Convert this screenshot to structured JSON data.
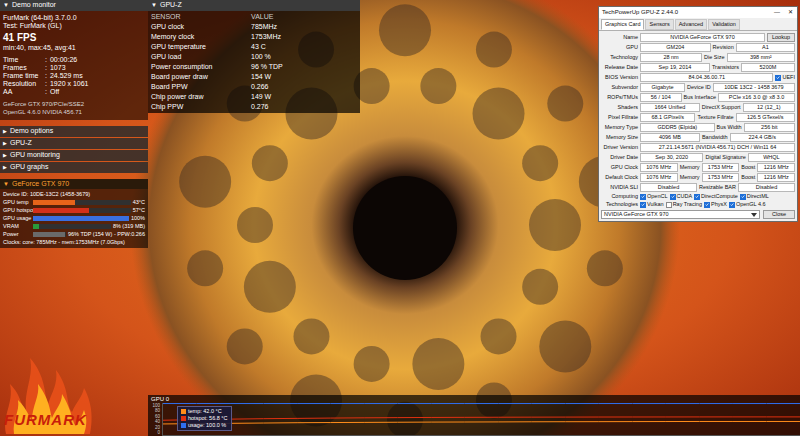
{
  "demo_monitor": {
    "title": "Demo monitor",
    "arrow": "▼",
    "header_lines": [
      "FurMark (64-bit) 3.7.0.0",
      "Test: FurMark (GL)"
    ],
    "fps": "41 FPS",
    "stats": "min:40, max:45, avg:41",
    "fields": [
      {
        "label": "Time",
        "value": "00:00:26"
      },
      {
        "label": "Frames",
        "value": "1073"
      },
      {
        "label": "Frame time",
        "value": "24.529 ms"
      },
      {
        "label": "Resolution",
        "value": "1920 x 1061"
      },
      {
        "label": "AA",
        "value": "Off"
      }
    ],
    "separator": ":",
    "gpu_lines": [
      "GeForce GTX 970/PCIe/SSE2",
      "OpenGL 4.6.0 NVIDIA 456.71"
    ],
    "menu": [
      {
        "label": "Demo options",
        "arrow": "▶",
        "expanded": false
      },
      {
        "label": "GPU-Z",
        "arrow": "▶",
        "expanded": false
      },
      {
        "label": "GPU monitoring",
        "arrow": "▶",
        "expanded": false
      },
      {
        "label": "GPU graphs",
        "arrow": "▶",
        "expanded": false
      }
    ]
  },
  "gpu_card": {
    "title": "GeForce GTX 970",
    "arrow": "▼",
    "expanded": true,
    "device": "Device ID: 10DE-13C2 (1458-3679)",
    "meters": [
      {
        "label": "GPU temp",
        "reading": "43°C",
        "level": 0.43,
        "color": "#e8641a"
      },
      {
        "label": "GPU hotspot",
        "reading": "57°C",
        "level": 0.57,
        "color": "#d4301a"
      },
      {
        "label": "GPU usage",
        "reading": "100%",
        "level": 1,
        "color": "#3a6fe0"
      },
      {
        "label": "VRAM",
        "reading": "8% (319 MB)",
        "level": 0.08,
        "color": "#2a9a3a"
      },
      {
        "label": "Power",
        "reading": "96% TDP (154 W) - PPW:0.266",
        "level": 0.96,
        "color": "#6a6a6a"
      }
    ],
    "clocks": "Clocks: core: 785MHz - mem:1753MHz (7.0Gbps)"
  },
  "gpuz_panel": {
    "title": "GPU-Z",
    "arrow": "▼",
    "columns": [
      "SENSOR",
      "VALUE"
    ],
    "rows": [
      {
        "sensor": "GPU clock",
        "value": "785MHz"
      },
      {
        "sensor": "Memory clock",
        "value": "1753MHz"
      },
      {
        "sensor": "GPU temperature",
        "value": "43 C"
      },
      {
        "sensor": "GPU load",
        "value": "100 %"
      },
      {
        "sensor": "Power consumption",
        "value": "96 % TDP"
      },
      {
        "sensor": "Board power draw",
        "value": "154 W"
      },
      {
        "sensor": "Board PPW",
        "value": "0.266"
      },
      {
        "sensor": "Chip power draw",
        "value": "149 W"
      },
      {
        "sensor": "Chip PPW",
        "value": "0.276"
      }
    ]
  },
  "gpuz_window": {
    "title": "TechPowerUp GPU-Z 2.44.0",
    "controls": [
      "—",
      "✕"
    ],
    "tabs": [
      {
        "label": "Graphics Card",
        "selected": true
      },
      {
        "label": "Sensors",
        "selected": false
      },
      {
        "label": "Advanced",
        "selected": false
      },
      {
        "label": "Validation",
        "selected": false
      }
    ],
    "rows": [
      {
        "items": [
          {
            "kind": "field",
            "label": "Name",
            "value": "NVIDIA GeForce GTX 970"
          },
          {
            "kind": "button",
            "label": "Lookup"
          }
        ]
      },
      {
        "items": [
          {
            "kind": "field",
            "label": "GPU",
            "value": "GM204"
          },
          {
            "kind": "field",
            "label": "Revision",
            "value": "A1"
          }
        ]
      },
      {
        "items": [
          {
            "kind": "field",
            "label": "Technology",
            "value": "28 nm"
          },
          {
            "kind": "field",
            "label": "Die Size",
            "value": "398 mm²"
          }
        ]
      },
      {
        "items": [
          {
            "kind": "field",
            "label": "Release Date",
            "value": "Sep 19, 2014"
          },
          {
            "kind": "field",
            "label": "Transistors",
            "value": "5200M"
          }
        ]
      },
      {
        "items": [
          {
            "kind": "field",
            "label": "BIOS Version",
            "value": "84.04.36.00.71"
          },
          {
            "kind": "checkbox",
            "label": "UEFI",
            "checked": true
          }
        ]
      },
      {
        "items": [
          {
            "kind": "field",
            "label": "Subvendor",
            "value": "Gigabyte"
          },
          {
            "kind": "field",
            "label": "Device ID",
            "value": "10DE 13C2 - 1458 3679"
          }
        ]
      },
      {
        "items": [
          {
            "kind": "field",
            "label": "ROPs/TMUs",
            "value": "56 / 104"
          },
          {
            "kind": "field",
            "label": "Bus Interface",
            "value": "PCIe x16 3.0 @ x8 3.0"
          }
        ]
      },
      {
        "items": [
          {
            "kind": "field",
            "label": "Shaders",
            "value": "1664 Unified"
          },
          {
            "kind": "field",
            "label": "DirectX Support",
            "value": "12 (12_1)"
          }
        ]
      },
      {
        "items": [
          {
            "kind": "field",
            "label": "Pixel Fillrate",
            "value": "68.1 GPixel/s"
          },
          {
            "kind": "field",
            "label": "Texture Fillrate",
            "value": "126.5 GTexel/s"
          }
        ]
      },
      {
        "items": [
          {
            "kind": "field",
            "label": "Memory Type",
            "value": "GDDR5 (Elpida)"
          },
          {
            "kind": "field",
            "label": "Bus Width",
            "value": "256 bit"
          }
        ]
      },
      {
        "items": [
          {
            "kind": "field",
            "label": "Memory Size",
            "value": "4096 MB"
          },
          {
            "kind": "field",
            "label": "Bandwidth",
            "value": "224.4 GB/s"
          }
        ]
      },
      {
        "items": [
          {
            "kind": "field",
            "label": "Driver Version",
            "value": "27.21.14.5671 (NVIDIA 456.71) DCH / Win11 64"
          }
        ]
      },
      {
        "items": [
          {
            "kind": "field",
            "label": "Driver Date",
            "value": "Sep 30, 2020"
          },
          {
            "kind": "field",
            "label": "Digital Signature",
            "value": "WHQL"
          }
        ]
      },
      {
        "items": [
          {
            "kind": "field",
            "label": "GPU Clock",
            "value": "1076 MHz"
          },
          {
            "kind": "field",
            "label": "Memory",
            "value": "1753 MHz"
          },
          {
            "kind": "field",
            "label": "Boost",
            "value": "1216 MHz"
          }
        ]
      },
      {
        "items": [
          {
            "kind": "field",
            "label": "Default Clock",
            "value": "1076 MHz"
          },
          {
            "kind": "field",
            "label": "Memory",
            "value": "1753 MHz"
          },
          {
            "kind": "field",
            "label": "Boost",
            "value": "1216 MHz"
          }
        ]
      },
      {
        "items": [
          {
            "kind": "field",
            "label": "NVIDIA SLI",
            "value": "Disabled"
          },
          {
            "kind": "field",
            "label": "Resizable BAR",
            "value": "Disabled"
          }
        ]
      },
      {
        "items": [
          {
            "kind": "label",
            "label": "Computing"
          },
          {
            "kind": "checkbox",
            "label": "OpenCL",
            "checked": true
          },
          {
            "kind": "checkbox",
            "label": "CUDA",
            "checked": true
          },
          {
            "kind": "checkbox",
            "label": "DirectCompute",
            "checked": true
          },
          {
            "kind": "checkbox",
            "label": "DirectML",
            "checked": true
          }
        ]
      },
      {
        "items": [
          {
            "kind": "label",
            "label": "Technologies"
          },
          {
            "kind": "checkbox",
            "label": "Vulkan",
            "checked": true
          },
          {
            "kind": "checkbox",
            "label": "Ray Tracing",
            "checked": false
          },
          {
            "kind": "checkbox",
            "label": "PhysX",
            "checked": true
          },
          {
            "kind": "checkbox",
            "label": "OpenGL 4.6",
            "checked": true
          }
        ]
      }
    ],
    "device_select": "NVIDIA GeForce GTX 970",
    "close_button": "Close"
  },
  "graph": {
    "title": "GPU 0",
    "ticks": [
      "100",
      "80",
      "60",
      "40",
      "20",
      "0"
    ],
    "max": 100,
    "series": [
      {
        "label": "temp: 42.0 °C",
        "color": "#ff8c1a",
        "values": [
          34,
          35,
          36,
          37,
          38,
          38.5,
          39,
          39.5,
          40,
          40.3,
          40.6,
          41,
          41.2,
          41.4,
          41.6,
          41.8,
          42,
          42,
          42,
          42
        ]
      },
      {
        "label": "hotspot: 56.8 °C",
        "color": "#e03010",
        "values": [
          46,
          48,
          49.5,
          51,
          52,
          53,
          53.8,
          54.4,
          55,
          55.4,
          55.7,
          56,
          56.2,
          56.4,
          56.5,
          56.6,
          56.7,
          56.8,
          56.8,
          56.8
        ]
      },
      {
        "label": "usage: 100.0 %",
        "color": "#2f6ff0",
        "values": [
          100,
          100,
          100,
          100,
          100,
          100,
          100,
          100,
          100,
          100,
          100,
          100,
          100,
          100,
          100,
          100,
          100,
          100,
          100,
          100
        ]
      }
    ]
  },
  "logo": {
    "text": "FURMARK"
  }
}
